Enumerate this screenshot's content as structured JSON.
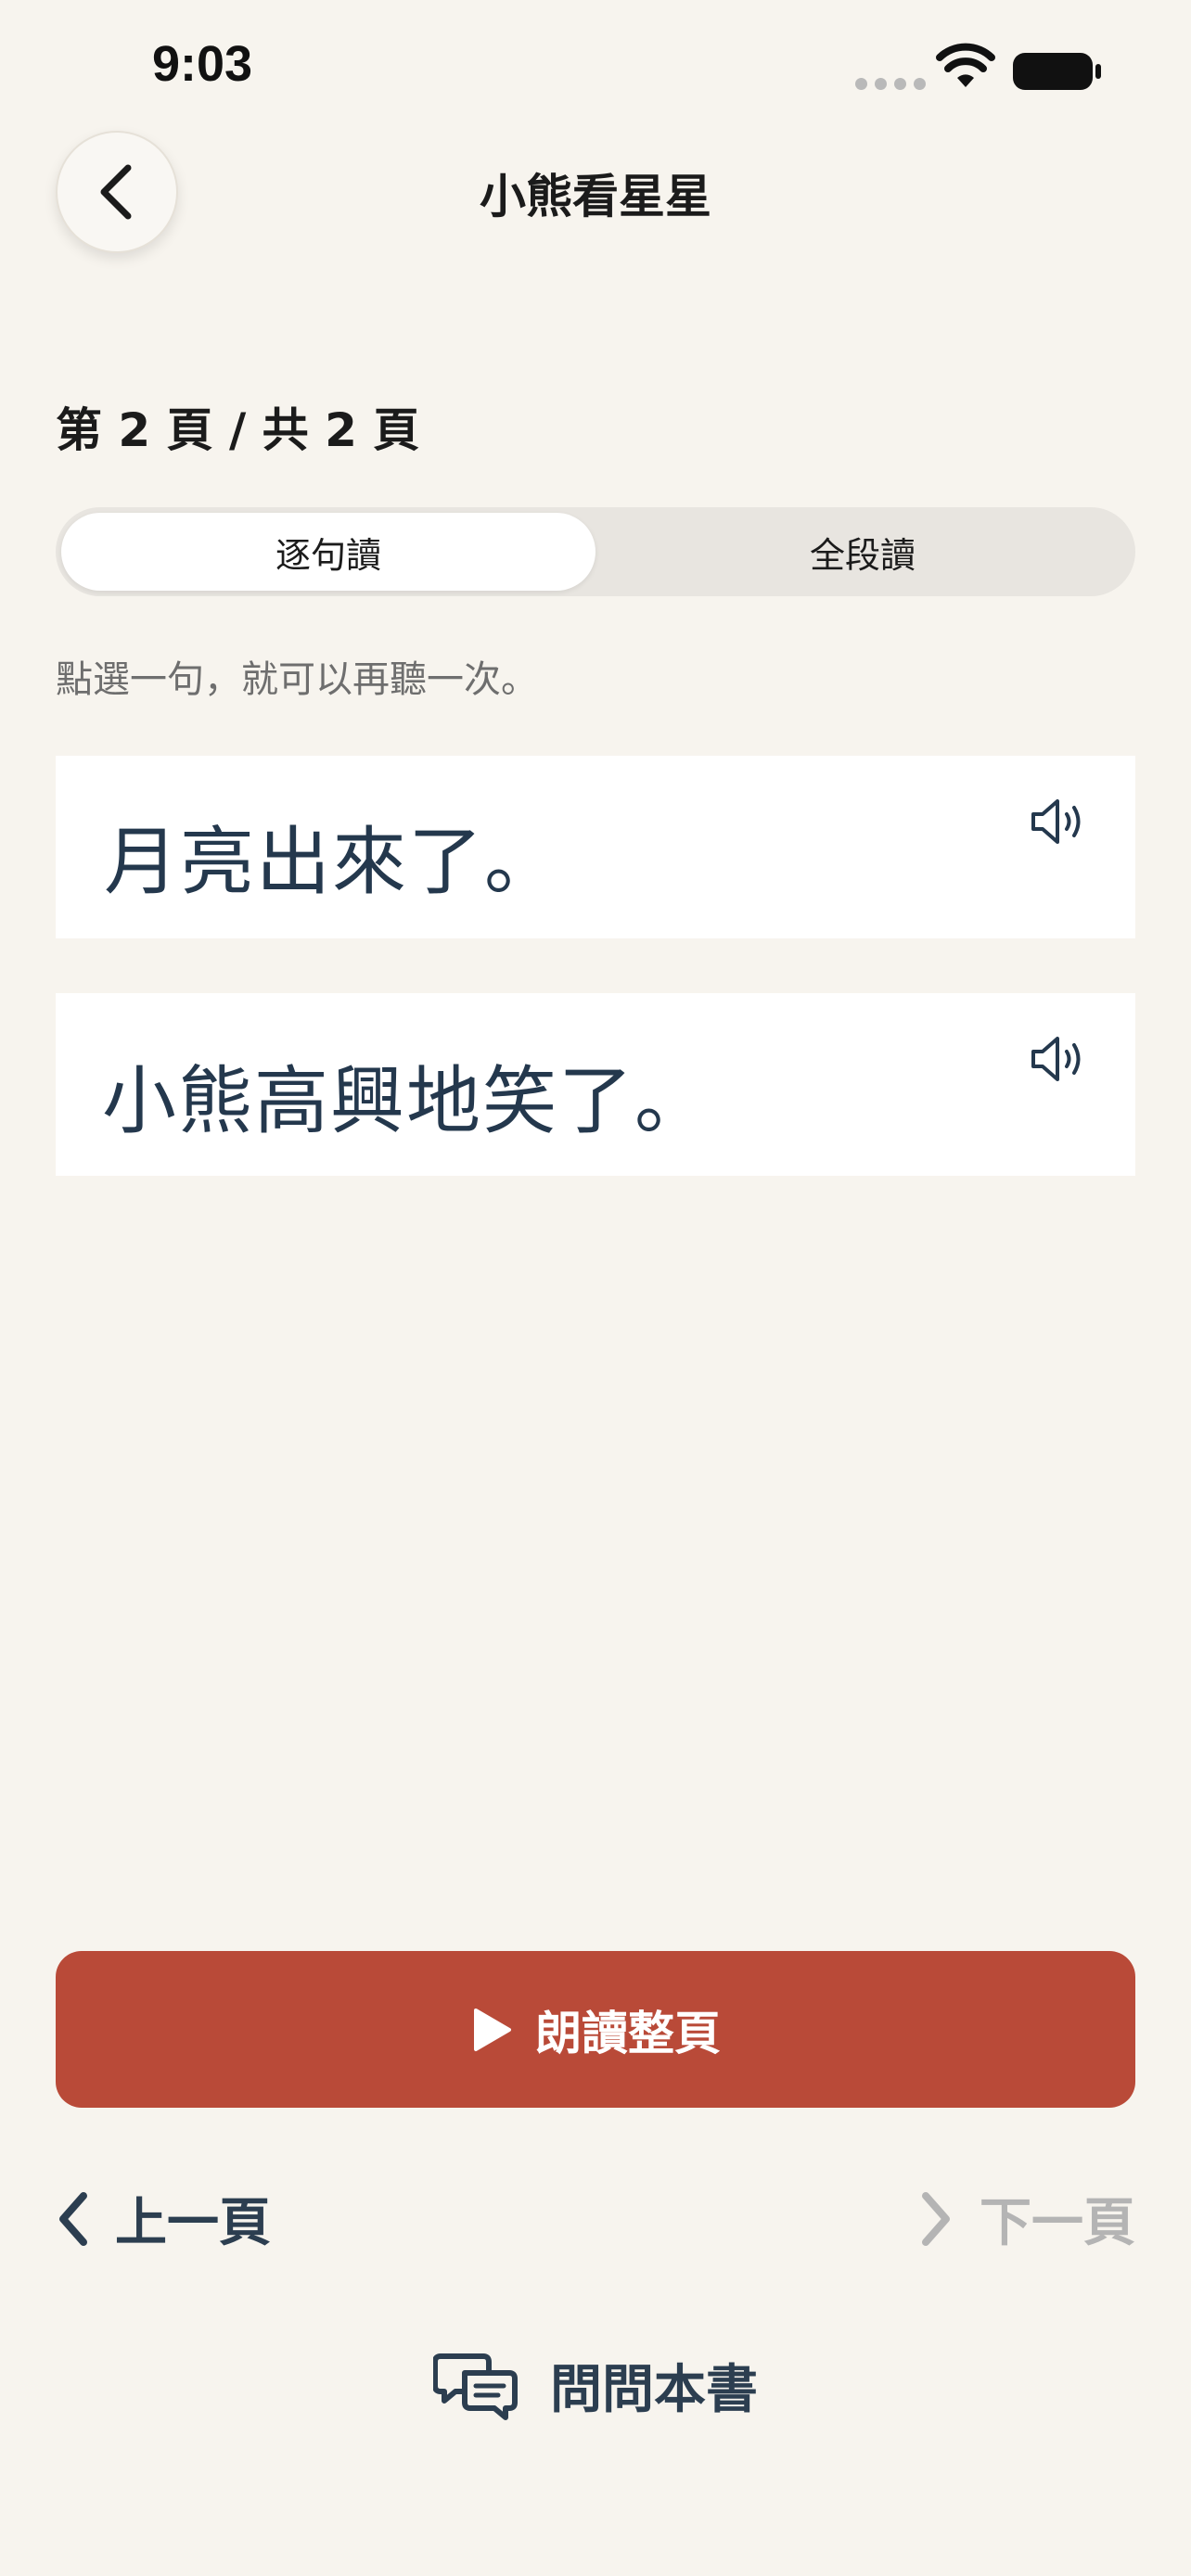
{
  "status_bar": {
    "time": "9:03"
  },
  "header": {
    "title": "小熊看星星",
    "back_icon": "chevron-left-icon"
  },
  "page_counter": "第 2 頁 / 共 2 頁",
  "mode_tabs": [
    {
      "label": "逐句讀",
      "selected": true
    },
    {
      "label": "全段讀",
      "selected": false
    }
  ],
  "hint": "點選一句，就可以再聽一次。",
  "sentences": [
    {
      "text": "月亮出來了。",
      "icon": "speaker-icon"
    },
    {
      "text": "小熊高興地笑了。",
      "icon": "speaker-icon"
    }
  ],
  "read_page": {
    "label": "朗讀整頁",
    "icon": "play-icon"
  },
  "pagination": {
    "prev_label": "上一頁",
    "next_label": "下一頁",
    "next_enabled": false
  },
  "ask_book": {
    "label": "問問本書",
    "icon": "chat-bubbles-icon"
  },
  "colors": {
    "background": "#F7F4EE",
    "accent": "#B94A38",
    "text_dark": "#2C3E50",
    "disabled": "#B4B4B4"
  }
}
